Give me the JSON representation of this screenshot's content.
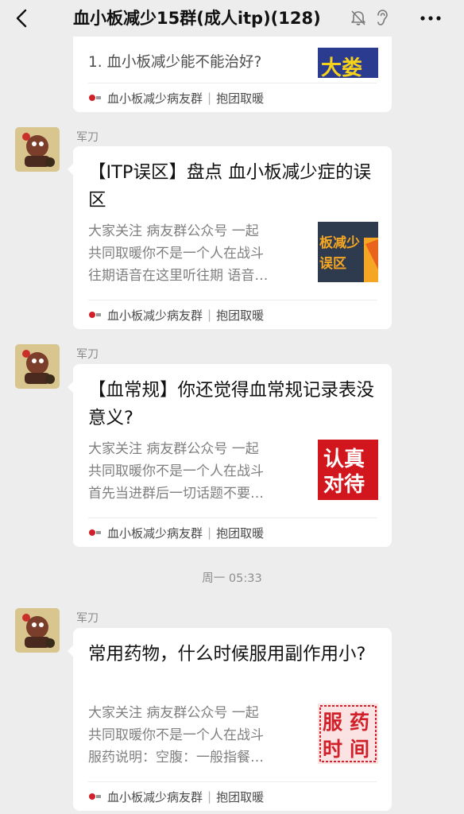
{
  "header": {
    "title": "血小板减少15群(成人itp)(128)"
  },
  "partial_card": {
    "line": "1. 血小板减少能不能治好?",
    "source": "血小板减少病友群",
    "source_tag": "抱团取暖"
  },
  "messages": [
    {
      "sender": "军刀",
      "title": "【ITP误区】盘点 血小板减少症的误区",
      "desc": [
        "大家关注 病友群公众号 一起",
        "共同取暖你不是一个人在战斗",
        "往期语音在这里听往期 语音…"
      ],
      "thumb": {
        "text1": "板减少",
        "text2": "误区",
        "bg": "#2e3a4e",
        "accent": "#f5a623"
      },
      "source": "血小板减少病友群",
      "source_tag": "抱团取暖"
    },
    {
      "sender": "军刀",
      "title": "【血常规】你还觉得血常规记录表没意义?",
      "desc": [
        "大家关注 病友群公众号 一起",
        "共同取暖你不是一个人在战斗",
        "首先当进群后一切话题不要…"
      ],
      "thumb": {
        "text1": "认真",
        "text2": "对待",
        "bg": "#d2161d",
        "accent": "#ffffff"
      },
      "source": "血小板减少病友群",
      "source_tag": "抱团取暖"
    },
    {
      "sender": "军刀",
      "title": "常用药物，什么时候服用副作用小?",
      "desc": [
        "大家关注 病友群公众号 一起",
        "共同取暖你不是一个人在战斗",
        "服药说明：空腹：一般指餐…"
      ],
      "thumb": {
        "text1": "服",
        "text2": "药",
        "text3": "时",
        "text4": "间",
        "bg": "#fbe3e3",
        "accent": "#d0202a"
      },
      "source": "血小板减少病友群",
      "source_tag": "抱团取暖"
    }
  ],
  "timestamp": "周一 05:33",
  "colors": {
    "background": "#ededed",
    "card": "#ffffff",
    "desc": "#7f7f7f"
  }
}
